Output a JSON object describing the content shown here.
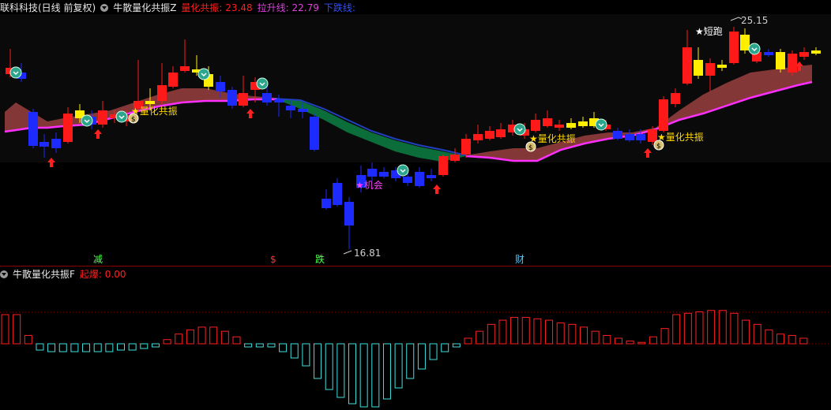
{
  "main": {
    "stock": "联科科技(日线 前复权)",
    "indicator": "牛散量化共振Z",
    "legend1_label": "量化共振:",
    "legend1_value": "23.48",
    "legend2_label": "拉升线:",
    "legend2_value": "22.79",
    "legend3_label": "下跌线:",
    "legend3_value": "",
    "colors": {
      "resonance": "#ff2020",
      "lift": "#e040e0",
      "fall": "#3050ff"
    },
    "price_high": "25.15",
    "price_low": "16.81",
    "labels": {
      "resonance": "★量化共振",
      "short_run": "★短跑",
      "chance": "★机会"
    },
    "bottom_marks": [
      "减",
      "$",
      "跌",
      "财"
    ]
  },
  "sub": {
    "indicator": "牛散量化共振F",
    "legend_label": "起爆:",
    "legend_value": "0.00"
  },
  "chart_data": {
    "type": "bar",
    "title": "牛散量化共振F",
    "series": [
      {
        "name": "起爆",
        "values": [
          42,
          42,
          12,
          -8,
          -10,
          -10,
          -10,
          -10,
          -10,
          -10,
          -8,
          -8,
          -6,
          -4,
          6,
          14,
          20,
          24,
          24,
          18,
          10,
          -4,
          -4,
          -4,
          -10,
          -18,
          -28,
          -44,
          -58,
          -68,
          -76,
          -80,
          -80,
          -70,
          -56,
          -44,
          -32,
          -20,
          -10,
          -4,
          8,
          18,
          28,
          34,
          38,
          38,
          36,
          34,
          30,
          28,
          24,
          18,
          12,
          8,
          4,
          2,
          10,
          22,
          42,
          44,
          46,
          48,
          48,
          44,
          34,
          28,
          20,
          14,
          12,
          8
        ]
      }
    ],
    "ylim": [
      -85,
      50
    ]
  }
}
